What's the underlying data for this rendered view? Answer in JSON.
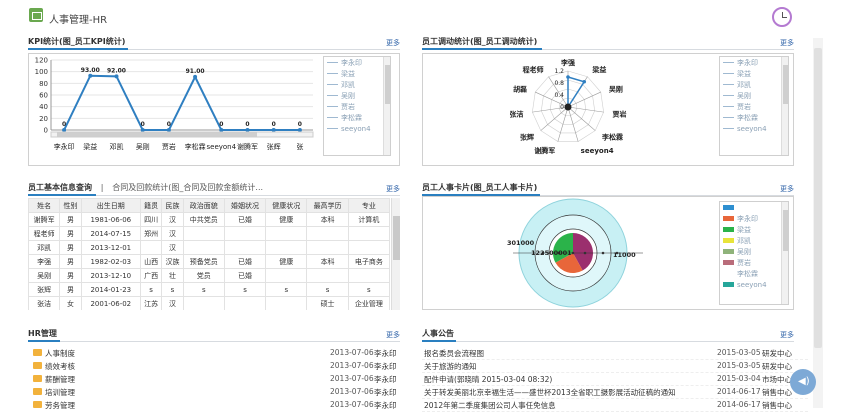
{
  "app": {
    "title": "人事管理-HR"
  },
  "more": "更多",
  "kpi": {
    "title": "KPI统计(图_员工KPI统计)",
    "legend": [
      "李永印",
      "梁益",
      "邓凯",
      "吴刚",
      "贾岩",
      "李松霖",
      "seeyon4"
    ]
  },
  "transfer": {
    "title": "员工调动统计(图_员工调动统计)",
    "legend": [
      "李永印",
      "梁益",
      "邓凯",
      "吴刚",
      "贾岩",
      "李松霖",
      "seeyon4"
    ]
  },
  "info": {
    "tab1": "员工基本信息查询",
    "sep": "|",
    "tab2": "合同及回款统计(图_合同及回款金额统计...",
    "columns": [
      "姓名",
      "性别",
      "出生日期",
      "籍贯",
      "民族",
      "政治面貌",
      "婚姻状况",
      "健康状况",
      "最高学历",
      "专业"
    ],
    "rows": [
      [
        "谢腾军",
        "男",
        "1981-06-06",
        "四川",
        "汉",
        "中共党员",
        "已婚",
        "健康",
        "本科",
        "计算机"
      ],
      [
        "程老师",
        "男",
        "2014-07-15",
        "郑州",
        "汉",
        "",
        "",
        "",
        "",
        ""
      ],
      [
        "邓凯",
        "男",
        "2013-12-01",
        "",
        "汉",
        "",
        "",
        "",
        "",
        ""
      ],
      [
        "李强",
        "男",
        "1982-02-03",
        "山西",
        "汉族",
        "预备党员",
        "已婚",
        "健康",
        "本科",
        "电子商务"
      ],
      [
        "吴刚",
        "男",
        "2013-12-10",
        "广西",
        "壮",
        "党员",
        "已婚",
        "",
        "",
        ""
      ],
      [
        "张辉",
        "男",
        "2014-01-23",
        "s",
        "s",
        "s",
        "s",
        "s",
        "s",
        "s"
      ],
      [
        "张洁",
        "女",
        "2001-06-02",
        "江苏",
        "汉",
        "",
        "",
        "",
        "硕士",
        "企业管理"
      ]
    ]
  },
  "card": {
    "title": "员工人事卡片(图_员工人事卡片)",
    "legend": [
      {
        "label": "",
        "color": "#2e8fd0"
      },
      {
        "label": "李永印",
        "color": "#e8663a"
      },
      {
        "label": "梁益",
        "color": "#2bb34a"
      },
      {
        "label": "邓凯",
        "color": "#e8e43a"
      },
      {
        "label": "吴刚",
        "color": "#8fb37a"
      },
      {
        "label": "贾岩",
        "color": "#b96c7a"
      },
      {
        "label": "李松霖",
        "color": ""
      },
      {
        "label": "seeyon4",
        "color": "#26a69a"
      }
    ]
  },
  "hr": {
    "title": "HR管理",
    "rows": [
      {
        "name": "人事制度",
        "date": "2013-07-06",
        "author": "李永印"
      },
      {
        "name": "绩效考核",
        "date": "2013-07-06",
        "author": "李永印"
      },
      {
        "name": "薪酬管理",
        "date": "2013-07-06",
        "author": "李永印"
      },
      {
        "name": "培训管理",
        "date": "2013-07-06",
        "author": "李永印"
      },
      {
        "name": "劳务管理",
        "date": "2013-07-06",
        "author": "李永印"
      }
    ]
  },
  "notice": {
    "title": "人事公告",
    "rows": [
      {
        "name": "报名委员会流程图",
        "date": "2015-03-05",
        "author": "研发中心"
      },
      {
        "name": "关于旅游的通知",
        "date": "2015-03-05",
        "author": "研发中心"
      },
      {
        "name": "配件申请(郭晓晴 2015-03-04 08:32)",
        "date": "2015-03-04",
        "author": "市场中心"
      },
      {
        "name": "关于转发美丽北京幸福生活——盛世杯2013全省职工摄影展活动征稿的通知",
        "date": "2014-06-17",
        "author": "销售中心"
      },
      {
        "name": "2012年第二季度集团公司人事任免信息",
        "date": "2014-06-17",
        "author": "销售中心"
      }
    ]
  },
  "chart_data": [
    {
      "type": "line",
      "title": "",
      "categories": [
        "李永印",
        "梁益",
        "邓凯",
        "吴刚",
        "贾岩",
        "李松霖",
        "seeyon4",
        "谢腾军",
        "张辉",
        "张"
      ],
      "values": [
        0,
        93,
        92,
        0,
        0,
        91,
        0,
        0,
        0,
        0
      ],
      "data_labels": [
        "0",
        "93.00",
        "92.00",
        "0",
        "0",
        "91.00",
        "0",
        "0",
        "0",
        "0"
      ],
      "y_ticks": [
        "0",
        "20",
        "40",
        "60",
        "80",
        "100",
        "120"
      ],
      "ylim": [
        0,
        120
      ],
      "grid": true
    },
    {
      "type": "radar",
      "title": "",
      "categories": [
        "李强",
        "梁益",
        "吴刚",
        "贾岩",
        "李松霖",
        "seeyon4",
        "谢腾军",
        "张辉",
        "张洁",
        "胡磊",
        "程老师"
      ],
      "values": [
        1.0,
        1,
        0,
        0,
        0,
        0,
        0,
        0,
        0,
        0,
        0
      ],
      "r_ticks": [
        "0",
        "0.4",
        "0.8",
        "1.2"
      ]
    },
    {
      "type": "pie",
      "title": "",
      "values": [
        301000,
        122500001,
        11000
      ],
      "data_labels": [
        "301000",
        "122500001",
        "11000"
      ]
    }
  ]
}
